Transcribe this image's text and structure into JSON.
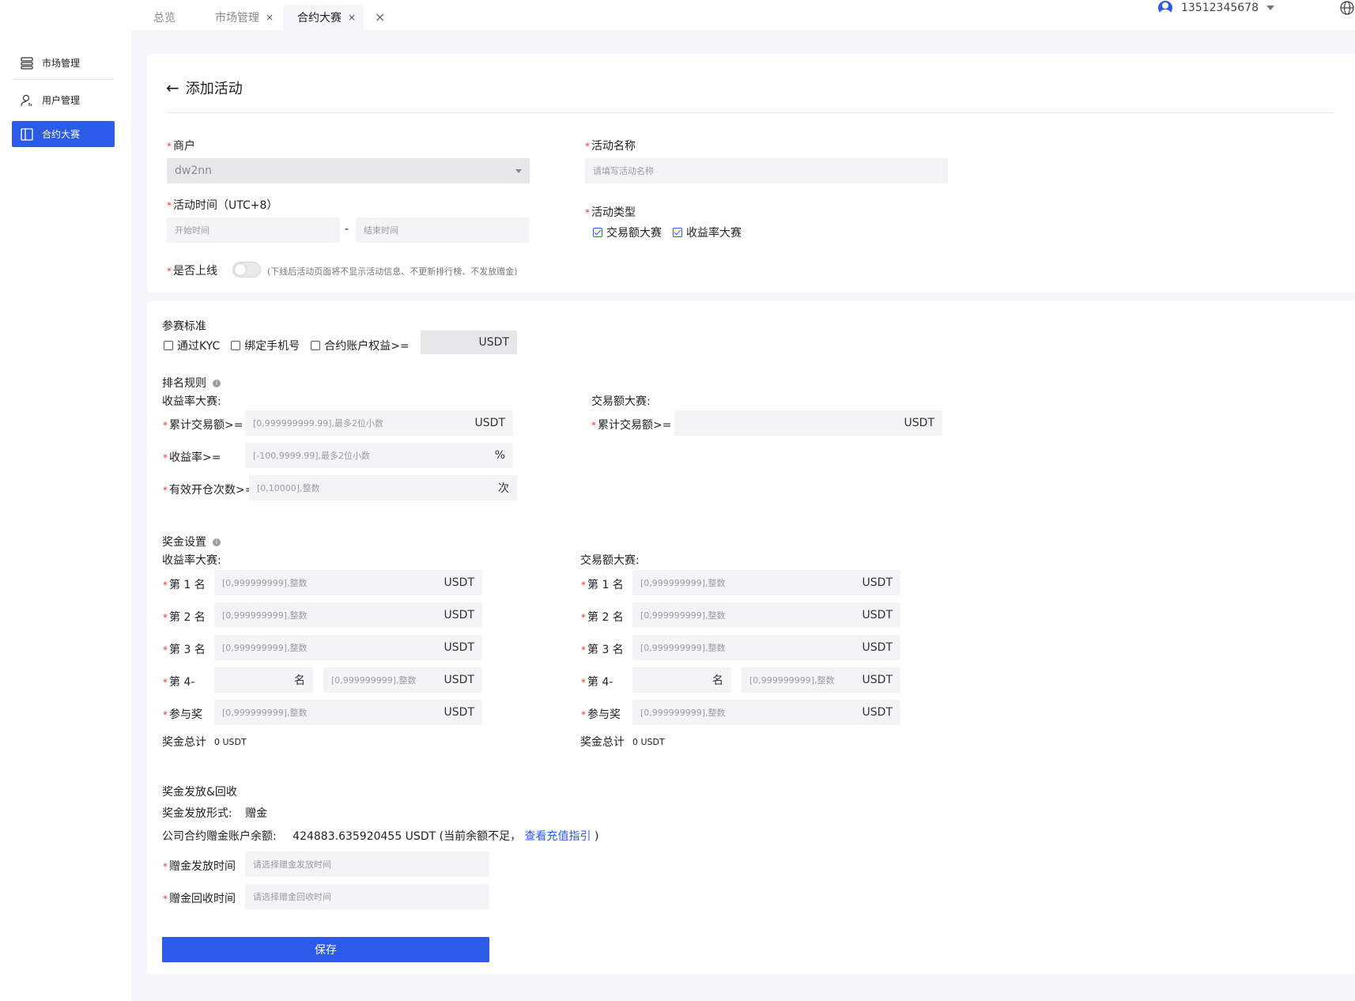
{
  "sidebar": {
    "items": [
      {
        "label": "市场管理"
      },
      {
        "label": "用户管理"
      },
      {
        "label": "合约大赛"
      }
    ]
  },
  "tabs": [
    {
      "label": "总览"
    },
    {
      "label": "市场管理",
      "close": "×"
    },
    {
      "label": "合约大赛",
      "close": "×"
    }
  ],
  "tabs_close_all": "×",
  "user": {
    "phone": "13512345678"
  },
  "page": {
    "back": "←",
    "title": "添加活动"
  },
  "basic": {
    "req": "*",
    "merchant_label": "商户",
    "merchant_value": "dw2nn",
    "activity_name_label": "活动名称",
    "activity_name_placeholder": "请填写活动名称",
    "time_label": "活动时间（UTC+8）",
    "start_placeholder": "开始时间",
    "time_sep": "-",
    "end_placeholder": "结束时间",
    "type_label": "活动类型",
    "type_volume": "交易额大赛",
    "type_yield": "收益率大赛",
    "online_label": "是否上线",
    "online_hint": "(下线后活动页面将不显示活动信息、不更新排行榜、不发放赠金)"
  },
  "criteria": {
    "title": "参赛标准",
    "kyc": "通过KYC",
    "phone": "绑定手机号",
    "equity": "合约账户权益>=",
    "unit": "USDT"
  },
  "ranking": {
    "title": "排名规则",
    "info": "i",
    "yield_title": "收益率大赛:",
    "volume_title": "交易额大赛:",
    "cum_volume_label": "累计交易额>=",
    "cum_volume_placeholder": "[0,999999999.99],最多2位小数",
    "usdt": "USDT",
    "yield_label": "收益率>=",
    "yield_placeholder": "[-100,9999.99],最多2位小数",
    "percent": "%",
    "opens_label": "有效开仓次数>=",
    "opens_placeholder": "[0,10000],整数",
    "times": "次"
  },
  "prizes": {
    "title": "奖金设置",
    "info": "i",
    "yield_title": "收益率大赛:",
    "volume_title": "交易额大赛:",
    "rank1": "第 1 名",
    "rank2": "第 2 名",
    "rank3": "第 3 名",
    "rank4": "第 4-",
    "ming": "名",
    "participation": "参与奖",
    "placeholder": "[0,999999999],整数",
    "usdt": "USDT",
    "total_label": "奖金总计",
    "total_value": "0 USDT"
  },
  "distribution": {
    "title": "奖金发放&回收",
    "form_label": "奖金发放形式:",
    "form_value": "赠金",
    "balance_label": "公司合约赠金账户余额:",
    "balance_value": "424883.635920455 USDT",
    "balance_note": "(当前余额不足，",
    "recharge_link": "查看充值指引",
    "balance_note_end": ")",
    "issue_label": "赠金发放时间",
    "issue_placeholder": "请选择赠金发放时间",
    "recall_label": "赠金回收时间",
    "recall_placeholder": "请选择赠金回收时间"
  },
  "save_label": "保存",
  "colors": {
    "primary": "#2c5ae9",
    "required": "#e53935"
  }
}
